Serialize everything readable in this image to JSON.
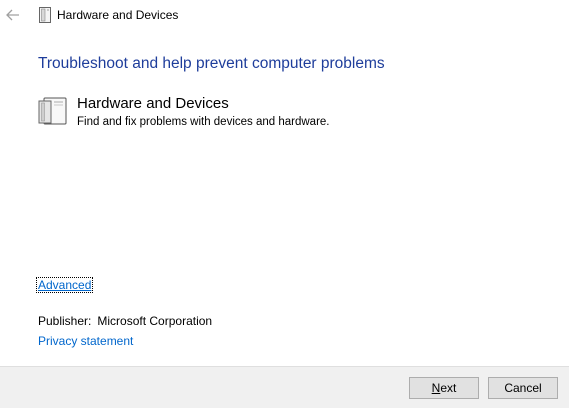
{
  "window": {
    "title": "Hardware and Devices",
    "back_icon": "back-arrow-icon",
    "title_icon": "hardware-devices-icon"
  },
  "main": {
    "heading": "Troubleshoot and help prevent computer problems",
    "item": {
      "icon": "hardware-devices-icon",
      "name": "Hardware and Devices",
      "description": "Find and fix problems with devices and hardware."
    },
    "advanced_link": "Advanced",
    "publisher_label": "Publisher:",
    "publisher_value": "Microsoft Corporation",
    "privacy_link": "Privacy statement"
  },
  "footer": {
    "next_label_mnemonic": "N",
    "next_label_rest": "ext",
    "cancel_label": "Cancel"
  },
  "colors": {
    "heading": "#1e3d9b",
    "link": "#0066cc",
    "footer_bg": "#f0f0f0",
    "button_bg": "#e1e1e1"
  }
}
